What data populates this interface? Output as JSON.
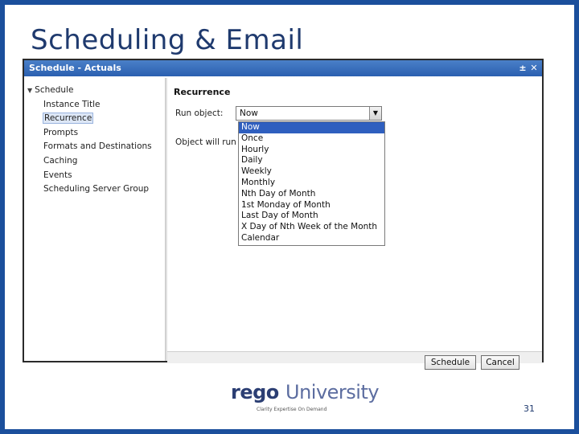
{
  "slide": {
    "title": "Scheduling & Email",
    "page_number": "31"
  },
  "window": {
    "title": "Schedule - Actuals",
    "controls": {
      "minimize": "±",
      "close": "✕"
    }
  },
  "tree": {
    "root": "Schedule",
    "items": [
      "Instance Title",
      "Recurrence",
      "Prompts",
      "Formats and Destinations",
      "Caching",
      "Events",
      "Scheduling Server Group"
    ],
    "selected": "Recurrence"
  },
  "recurrence": {
    "section_title": "Recurrence",
    "run_object_label": "Run object:",
    "run_object_value": "Now",
    "object_will_run_label": "Object will run",
    "options": [
      "Now",
      "Once",
      "Hourly",
      "Daily",
      "Weekly",
      "Monthly",
      "Nth Day of Month",
      "1st Monday of Month",
      "Last Day of Month",
      "X Day of Nth Week of the Month",
      "Calendar"
    ],
    "highlighted_option": "Now"
  },
  "buttons": {
    "schedule": "Schedule",
    "cancel": "Cancel"
  },
  "logo": {
    "part1": "rego",
    "part2": "University",
    "tagline": "Clarity Expertise On Demand"
  },
  "colors": {
    "frame": "#1b4f9c",
    "title": "#1f3a6e",
    "titlebar": "#2a5fb0",
    "highlight": "#2f5fbf"
  }
}
